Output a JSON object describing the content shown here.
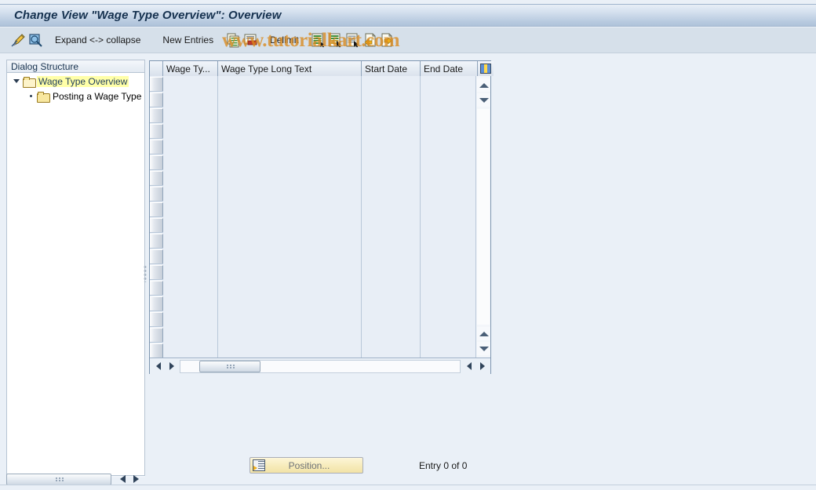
{
  "window": {
    "title": "Change View \"Wage Type Overview\": Overview"
  },
  "toolbar": {
    "icons": [
      {
        "name": "pencil-display-change-icon",
        "glyph": "pencil"
      },
      {
        "name": "magnifier-check-icon",
        "glyph": "magnifier"
      }
    ],
    "expand_collapse_label": "Expand <-> collapse",
    "new_entries_label": "New Entries",
    "delimit_label": "Delimit",
    "action_icons": [
      {
        "name": "copy-as-icon",
        "glyph": "copy"
      },
      {
        "name": "delete-row-icon",
        "glyph": "delete"
      },
      {
        "name": "select-all-icon",
        "glyph": "doc-green-arrow"
      },
      {
        "name": "select-block-icon",
        "glyph": "doc-green-cursor"
      },
      {
        "name": "deselect-all-icon",
        "glyph": "doc-lines-cursor"
      },
      {
        "name": "previous-entry-icon",
        "glyph": "doc-arrow-left"
      },
      {
        "name": "next-entry-icon",
        "glyph": "doc-arrow-right"
      }
    ],
    "watermark_text": "www.tutorialkart.com"
  },
  "sidebar": {
    "header": "Dialog Structure",
    "items": [
      {
        "label": "Wage Type Overview",
        "level": 1,
        "expanded": true,
        "selected": true,
        "icon": "open-folder-icon"
      },
      {
        "label": "Posting a Wage Type",
        "level": 2,
        "expanded": false,
        "selected": false,
        "icon": "folder-icon"
      }
    ]
  },
  "table": {
    "columns": [
      {
        "key": "wage_type",
        "label": "Wage Ty..."
      },
      {
        "key": "wage_type_long_text",
        "label": "Wage Type Long Text"
      },
      {
        "key": "start_date",
        "label": "Start Date"
      },
      {
        "key": "end_date",
        "label": "End Date"
      }
    ],
    "settings_icon": "table-settings-icon",
    "rows": [],
    "visible_row_count": 18
  },
  "footer": {
    "position_button_label": "Position...",
    "entry_status": "Entry 0 of 0"
  },
  "colors": {
    "title_accent": "#15314f",
    "selection_highlight": "#ffffa8",
    "panel_border": "#7e96b0",
    "background": "#eaf0f7",
    "watermark": "#d98a1e",
    "button_yellow": "#f7ecbd"
  }
}
